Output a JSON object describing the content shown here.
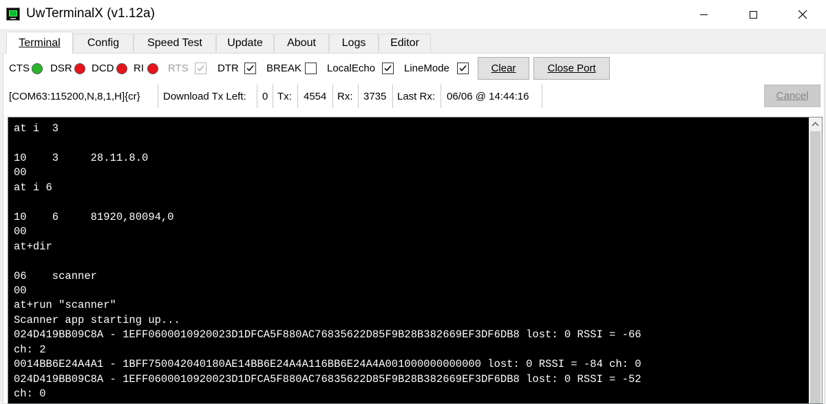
{
  "window": {
    "title": "UwTerminalX (v1.12a)",
    "icon": "terminal-app-icon",
    "controls": [
      "minimize-icon",
      "maximize-icon",
      "close-icon"
    ]
  },
  "tabs": [
    {
      "label": "Terminal",
      "active": true
    },
    {
      "label": "Config",
      "active": false
    },
    {
      "label": "Speed Test",
      "active": false
    },
    {
      "label": "Update",
      "active": false
    },
    {
      "label": "About",
      "active": false
    },
    {
      "label": "Logs",
      "active": false
    },
    {
      "label": "Editor",
      "active": false
    }
  ],
  "signals": {
    "cts": {
      "label": "CTS",
      "color": "#2ab52a"
    },
    "dsr": {
      "label": "DSR",
      "color": "#e8141b"
    },
    "dcd": {
      "label": "DCD",
      "color": "#e8141b"
    },
    "ri": {
      "label": "RI",
      "color": "#e8141b"
    }
  },
  "options": {
    "rts": {
      "label": "RTS",
      "checked": true,
      "enabled": false
    },
    "dtr": {
      "label": "DTR",
      "checked": true,
      "enabled": true
    },
    "break": {
      "label": "BREAK",
      "checked": false,
      "enabled": true
    },
    "localecho": {
      "label": "LocalEcho",
      "checked": true,
      "enabled": true
    },
    "linemode": {
      "label": "LineMode",
      "checked": true,
      "enabled": true
    }
  },
  "buttons": {
    "clear": "Clear",
    "close_port": "Close Port",
    "cancel": "Cancel"
  },
  "status": {
    "port": "[COM63:115200,N,8,1,H]{cr}",
    "download_label": "Download Tx Left:",
    "download_value": "0",
    "tx_label": "Tx:",
    "tx_value": "4554",
    "rx_label": "Rx:",
    "rx_value": "3735",
    "last_rx_label": "Last Rx:",
    "last_rx_value": "06/06 @ 14:44:16"
  },
  "terminal": {
    "output": "at i  3\n\n10    3     28.11.8.0\n00\nat i 6\n\n10    6     81920,80094,0\n00\nat+dir\n\n06    scanner\n00\nat+run \"scanner\"\nScanner app starting up...\n024D419BB09C8A - 1EFF0600010920023D1DFCA5F880AC76835622D85F9B28B382669EF3DF6DB8 lost: 0 RSSI = -66\nch: 2\n0014BB6E24A4A1 - 1BFF750042040180AE14BB6E24A4A116BB6E24A4A001000000000000 lost: 0 RSSI = -84 ch: 0\n024D419BB09C8A - 1EFF0600010920023D1DFCA5F880AC76835622D85F9B28B382669EF3DF6DB8 lost: 0 RSSI = -52\nch: 0"
  }
}
